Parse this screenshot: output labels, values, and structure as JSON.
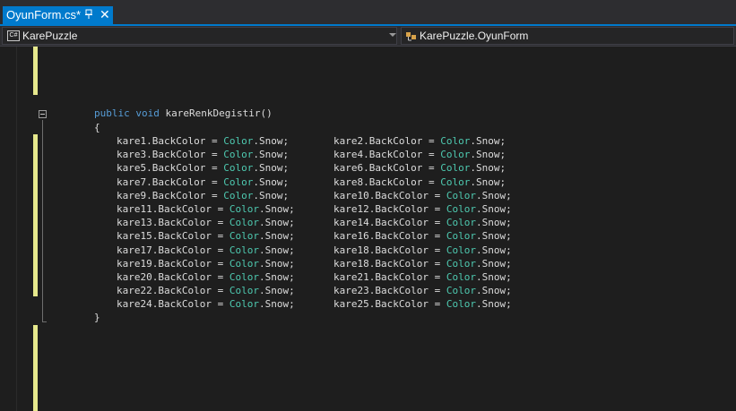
{
  "tab": {
    "title": "OyunForm.cs*",
    "pin_icon": "pin-icon",
    "close_glyph": "✕"
  },
  "navigation": {
    "project": "KarePuzzle",
    "project_icon_text": "C#",
    "class": "KarePuzzle.OyunForm"
  },
  "code": {
    "method_modifier": "public",
    "method_return": "void",
    "method_signature": "kareRenkDegistir()",
    "open_brace": "{",
    "close_brace": "}",
    "assignments": [
      {
        "var": "kare1",
        "prop": ".BackColor = ",
        "type": "Color",
        "val": ".Snow;"
      },
      {
        "var": "kare2",
        "prop": ".BackColor = ",
        "type": "Color",
        "val": ".Snow;"
      },
      {
        "var": "kare3",
        "prop": ".BackColor = ",
        "type": "Color",
        "val": ".Snow;"
      },
      {
        "var": "kare4",
        "prop": ".BackColor = ",
        "type": "Color",
        "val": ".Snow;"
      },
      {
        "var": "kare5",
        "prop": ".BackColor = ",
        "type": "Color",
        "val": ".Snow;"
      },
      {
        "var": "kare6",
        "prop": ".BackColor = ",
        "type": "Color",
        "val": ".Snow;"
      },
      {
        "var": "kare7",
        "prop": ".BackColor = ",
        "type": "Color",
        "val": ".Snow;"
      },
      {
        "var": "kare8",
        "prop": ".BackColor = ",
        "type": "Color",
        "val": ".Snow;"
      },
      {
        "var": "kare9",
        "prop": ".BackColor = ",
        "type": "Color",
        "val": ".Snow;"
      },
      {
        "var": "kare10",
        "prop": ".BackColor = ",
        "type": "Color",
        "val": ".Snow;"
      },
      {
        "var": "kare11",
        "prop": ".BackColor = ",
        "type": "Color",
        "val": ".Snow;"
      },
      {
        "var": "kare12",
        "prop": ".BackColor = ",
        "type": "Color",
        "val": ".Snow;"
      },
      {
        "var": "kare13",
        "prop": ".BackColor = ",
        "type": "Color",
        "val": ".Snow;"
      },
      {
        "var": "kare14",
        "prop": ".BackColor = ",
        "type": "Color",
        "val": ".Snow;"
      },
      {
        "var": "kare15",
        "prop": ".BackColor = ",
        "type": "Color",
        "val": ".Snow;"
      },
      {
        "var": "kare16",
        "prop": ".BackColor = ",
        "type": "Color",
        "val": ".Snow;"
      },
      {
        "var": "kare17",
        "prop": ".BackColor = ",
        "type": "Color",
        "val": ".Snow;"
      },
      {
        "var": "kare18",
        "prop": ".BackColor = ",
        "type": "Color",
        "val": ".Snow;"
      },
      {
        "var": "kare19",
        "prop": ".BackColor = ",
        "type": "Color",
        "val": ".Snow;"
      },
      {
        "var": "kare18",
        "prop": ".BackColor = ",
        "type": "Color",
        "val": ".Snow;"
      },
      {
        "var": "kare20",
        "prop": ".BackColor = ",
        "type": "Color",
        "val": ".Snow;"
      },
      {
        "var": "kare21",
        "prop": ".BackColor = ",
        "type": "Color",
        "val": ".Snow;"
      },
      {
        "var": "kare22",
        "prop": ".BackColor = ",
        "type": "Color",
        "val": ".Snow;"
      },
      {
        "var": "kare23",
        "prop": ".BackColor = ",
        "type": "Color",
        "val": ".Snow;"
      },
      {
        "var": "kare24",
        "prop": ".BackColor = ",
        "type": "Color",
        "val": ".Snow;"
      },
      {
        "var": "kare25",
        "prop": ".BackColor = ",
        "type": "Color",
        "val": ".Snow;"
      }
    ]
  },
  "colors": {
    "accent": "#007acc",
    "keyword": "#569cd6",
    "type": "#4ec9b0",
    "text": "#dcdcdc",
    "changed_line": "#e6e88c"
  }
}
